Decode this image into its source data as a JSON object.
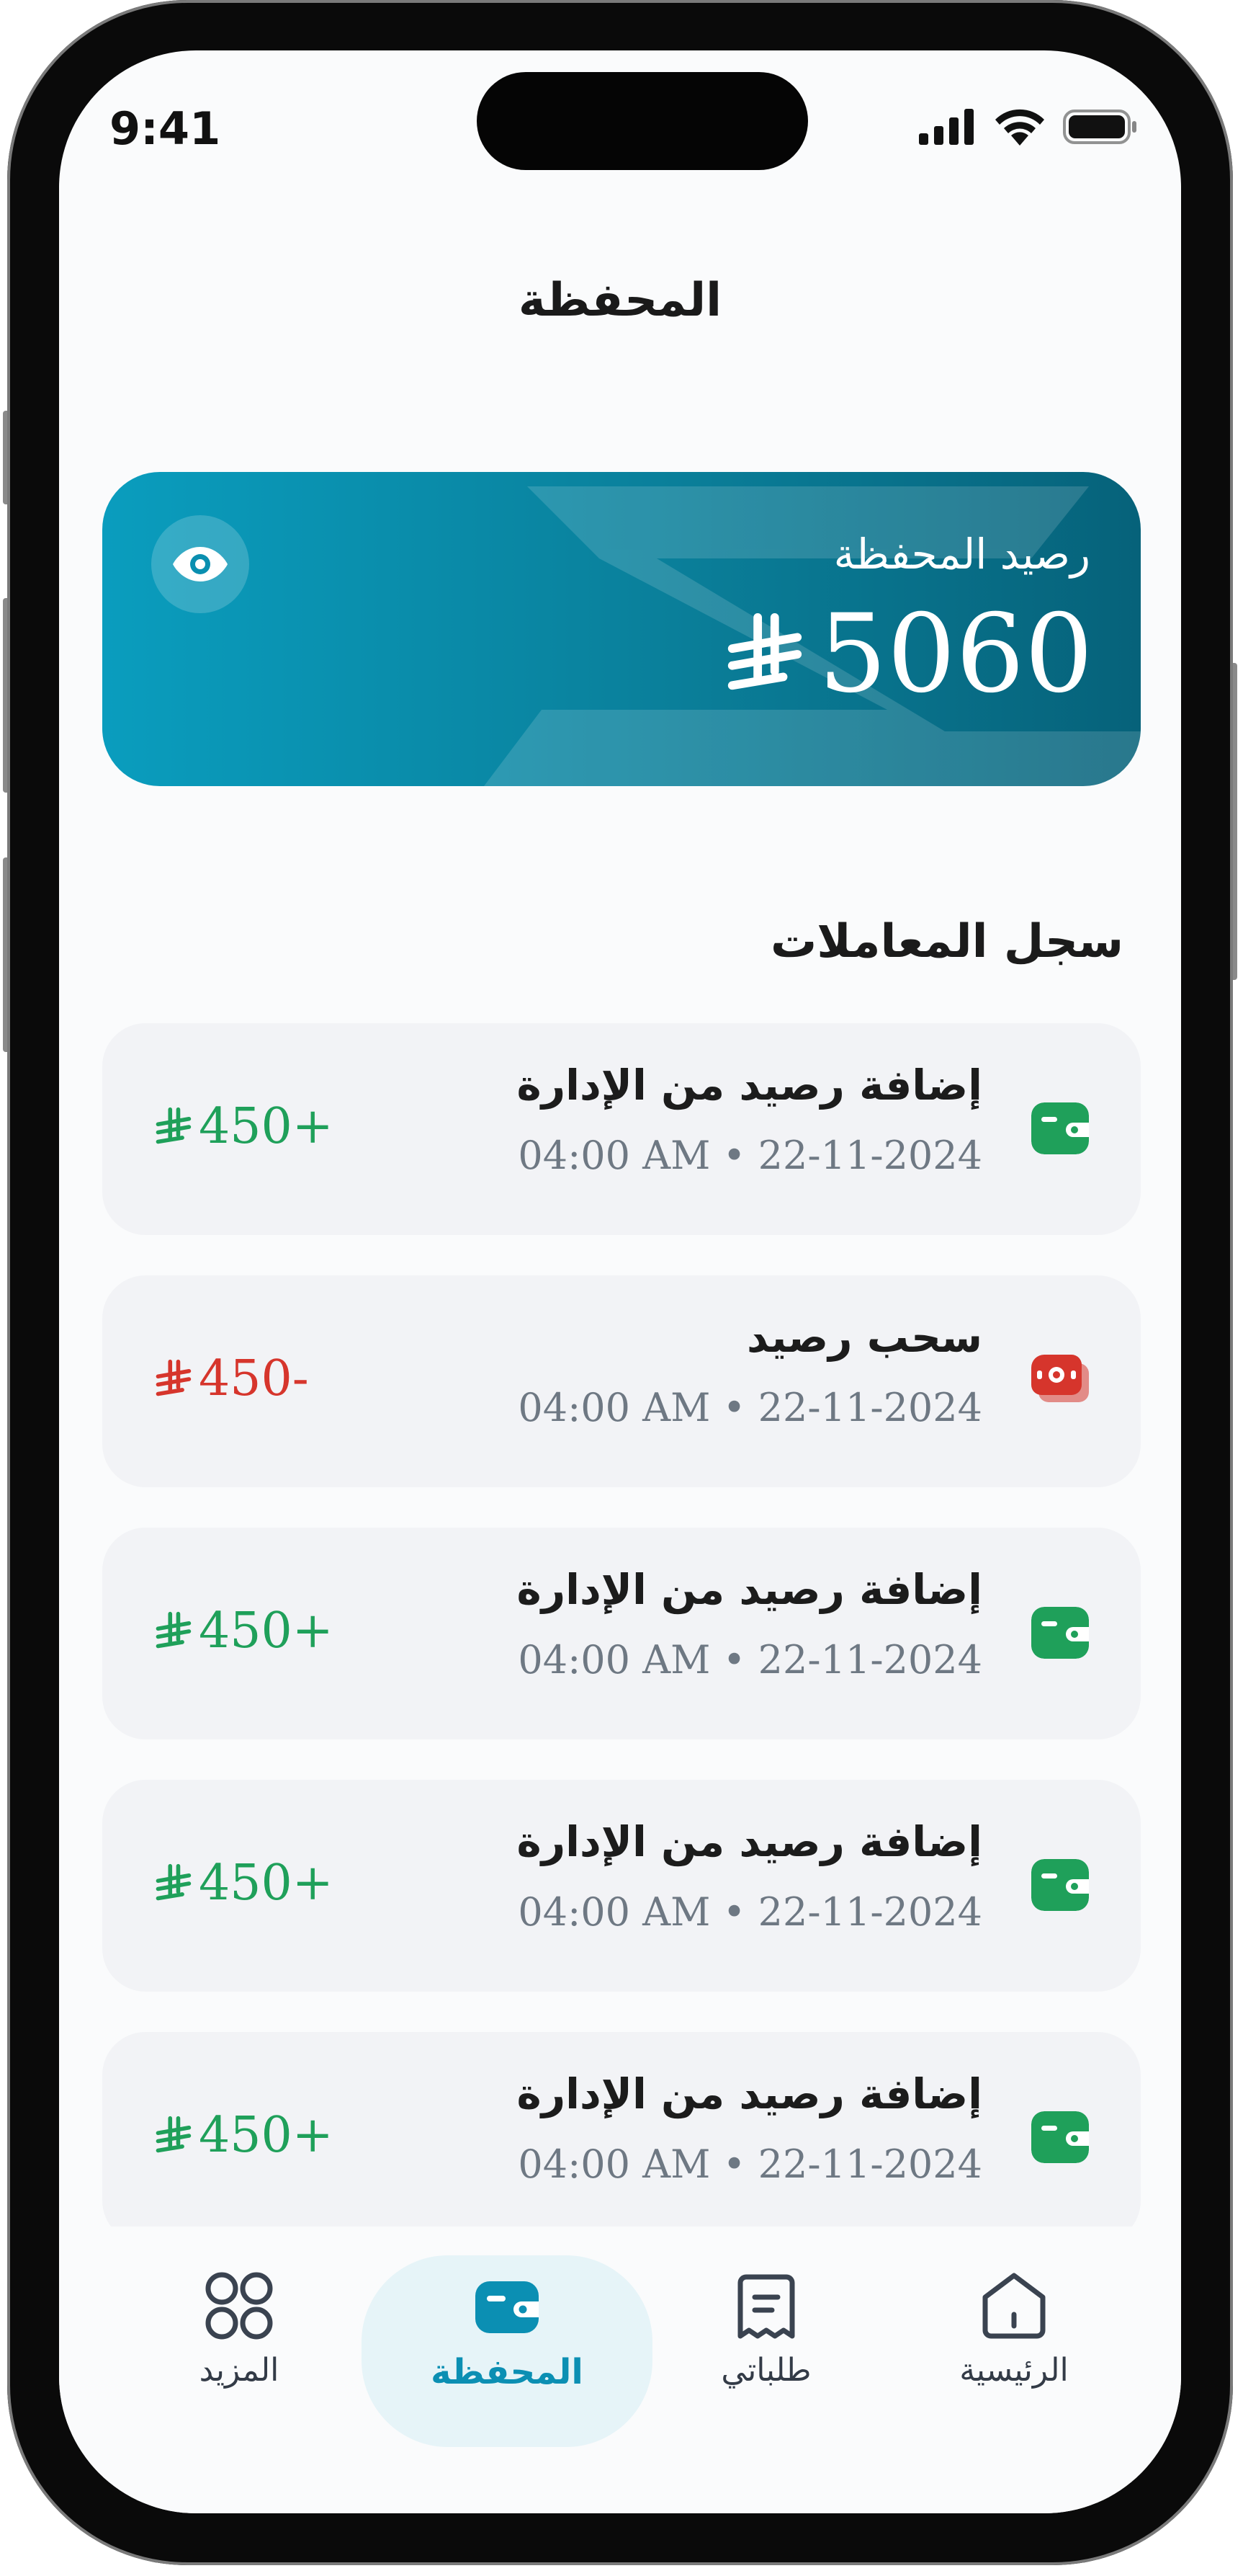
{
  "status_bar": {
    "time": "9:41"
  },
  "header": {
    "title": "المحفظة"
  },
  "balance_card": {
    "label": "رصيد المحفظة",
    "amount": "5060"
  },
  "transactions_section": {
    "title": "سجل المعاملات"
  },
  "transactions": [
    {
      "title": "إضافة رصيد من الإدارة",
      "datetime": "04:00 AM • 22-11-2024",
      "amount": "450+",
      "type": "credit"
    },
    {
      "title": "سحب رصيد",
      "datetime": "04:00 AM • 22-11-2024",
      "amount": "450-",
      "type": "debit"
    },
    {
      "title": "إضافة رصيد من الإدارة",
      "datetime": "04:00 AM • 22-11-2024",
      "amount": "450+",
      "type": "credit"
    },
    {
      "title": "إضافة رصيد من الإدارة",
      "datetime": "04:00 AM • 22-11-2024",
      "amount": "450+",
      "type": "credit"
    },
    {
      "title": "إضافة رصيد من الإدارة",
      "datetime": "04:00 AM • 22-11-2024",
      "amount": "450+",
      "type": "credit"
    }
  ],
  "bottom_nav": {
    "items": [
      {
        "label": "المزيد",
        "icon": "grid-icon",
        "active": false
      },
      {
        "label": "المحفظة",
        "icon": "wallet-icon",
        "active": true
      },
      {
        "label": "طلباتي",
        "icon": "receipt-icon",
        "active": false
      },
      {
        "label": "الرئيسية",
        "icon": "home-icon",
        "active": false
      }
    ]
  },
  "colors": {
    "accent": "#0B8FB3",
    "credit": "#1FA05A",
    "debit": "#D6352C",
    "card_gradient_start": "#0A9DBE",
    "card_gradient_end": "#06627A"
  }
}
